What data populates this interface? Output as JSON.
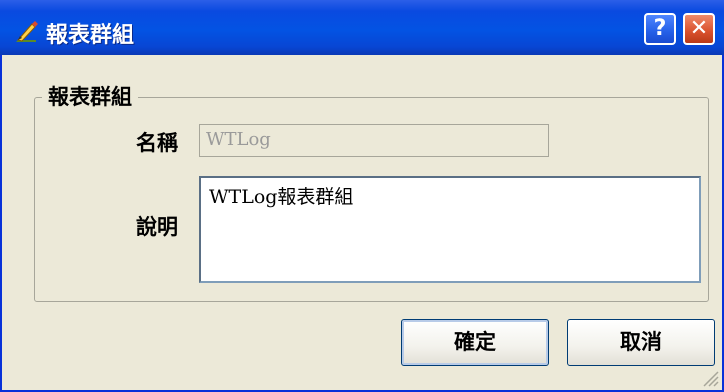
{
  "window": {
    "title": "報表群組"
  },
  "titlebar_buttons": {
    "help": "?",
    "close": "✕"
  },
  "group": {
    "legend": "報表群組"
  },
  "form": {
    "name_label": "名稱",
    "name_value": "WTLog",
    "desc_label": "說明",
    "desc_value": "WTLog報表群組"
  },
  "buttons": {
    "ok": "確定",
    "cancel": "取消"
  },
  "colors": {
    "titlebar": "#0353e3",
    "window_bg": "#ece9d8",
    "close": "#d9502c"
  }
}
